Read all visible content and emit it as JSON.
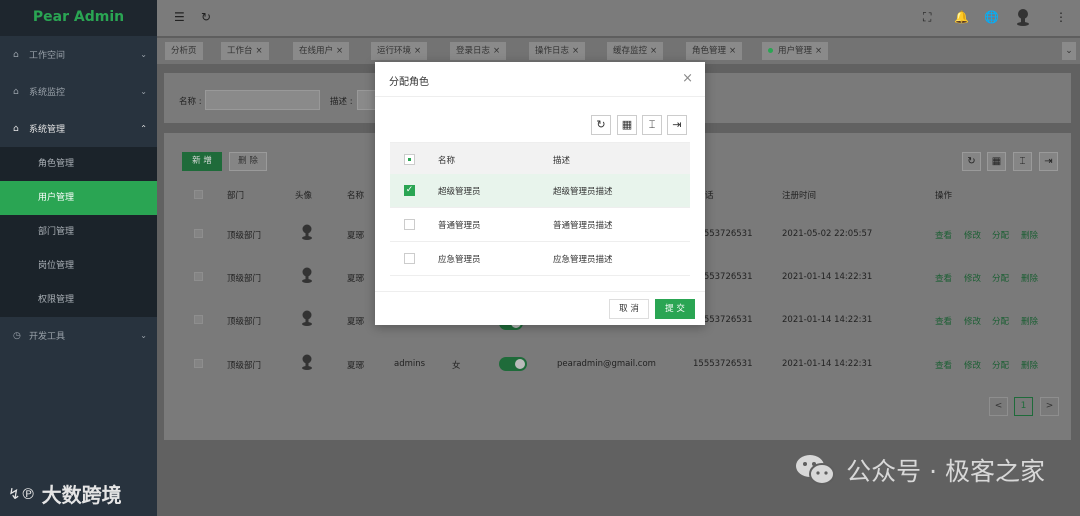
{
  "app": {
    "logo": "Pear Admin"
  },
  "sidebar": {
    "groups": [
      {
        "label": "工作空间",
        "icon": "home-icon"
      },
      {
        "label": "系统监控",
        "icon": "home-icon"
      },
      {
        "label": "系统管理",
        "icon": "home-icon"
      },
      {
        "label": "开发工具",
        "icon": "clock-icon"
      }
    ],
    "items": [
      "角色管理",
      "用户管理",
      "部门管理",
      "岗位管理",
      "权限管理"
    ],
    "active_item": "用户管理"
  },
  "tabs": [
    {
      "label": "分析页"
    },
    {
      "label": "工作台"
    },
    {
      "label": "在线用户"
    },
    {
      "label": "运行环境"
    },
    {
      "label": "登录日志"
    },
    {
      "label": "操作日志"
    },
    {
      "label": "缓存监控"
    },
    {
      "label": "角色管理"
    },
    {
      "label": "用户管理"
    }
  ],
  "search": {
    "name_label": "名称 :",
    "desc_label": "描述 :"
  },
  "toolbar": {
    "add_label": "新 增",
    "delete_label": "删 除"
  },
  "table": {
    "headers": [
      "部门",
      "头像",
      "名称",
      "话",
      "注册时间",
      "操作"
    ],
    "rows": [
      {
        "dept": "顶级部门",
        "name": "夏琊",
        "phone": "15553726531",
        "time": "2021-05-02 22:05:57"
      },
      {
        "dept": "顶级部门",
        "name": "夏琊",
        "phone": "15553726531",
        "time": "2021-01-14 14:22:31"
      },
      {
        "dept": "顶级部门",
        "name": "夏琊",
        "phone": "15553726531",
        "time": "2021-01-14 14:22:31"
      },
      {
        "dept": "顶级部门",
        "name": "夏琊",
        "account": "admins",
        "gender": "女",
        "email": "pearadmin@gmail.com",
        "phone": "15553726531",
        "time": "2021-01-14 14:22:31"
      }
    ],
    "actions": [
      "查看",
      "修改",
      "分配",
      "删除"
    ]
  },
  "pager": {
    "current": "1",
    "prev": "<",
    "next": ">"
  },
  "modal": {
    "title": "分配角色",
    "headers": {
      "name": "名称",
      "desc": "描述"
    },
    "rows": [
      {
        "name": "超级管理员",
        "desc": "超级管理员描述",
        "checked": true
      },
      {
        "name": "普通管理员",
        "desc": "普通管理员描述",
        "checked": false
      },
      {
        "name": "应急管理员",
        "desc": "应急管理员描述",
        "checked": false
      }
    ],
    "cancel_label": "取 消",
    "submit_label": "提 交"
  },
  "watermarks": {
    "left": "大数跨境",
    "right": "公众号 · 极客之家"
  },
  "colors": {
    "accent": "#2aa553",
    "sidebar": "#28333e"
  }
}
